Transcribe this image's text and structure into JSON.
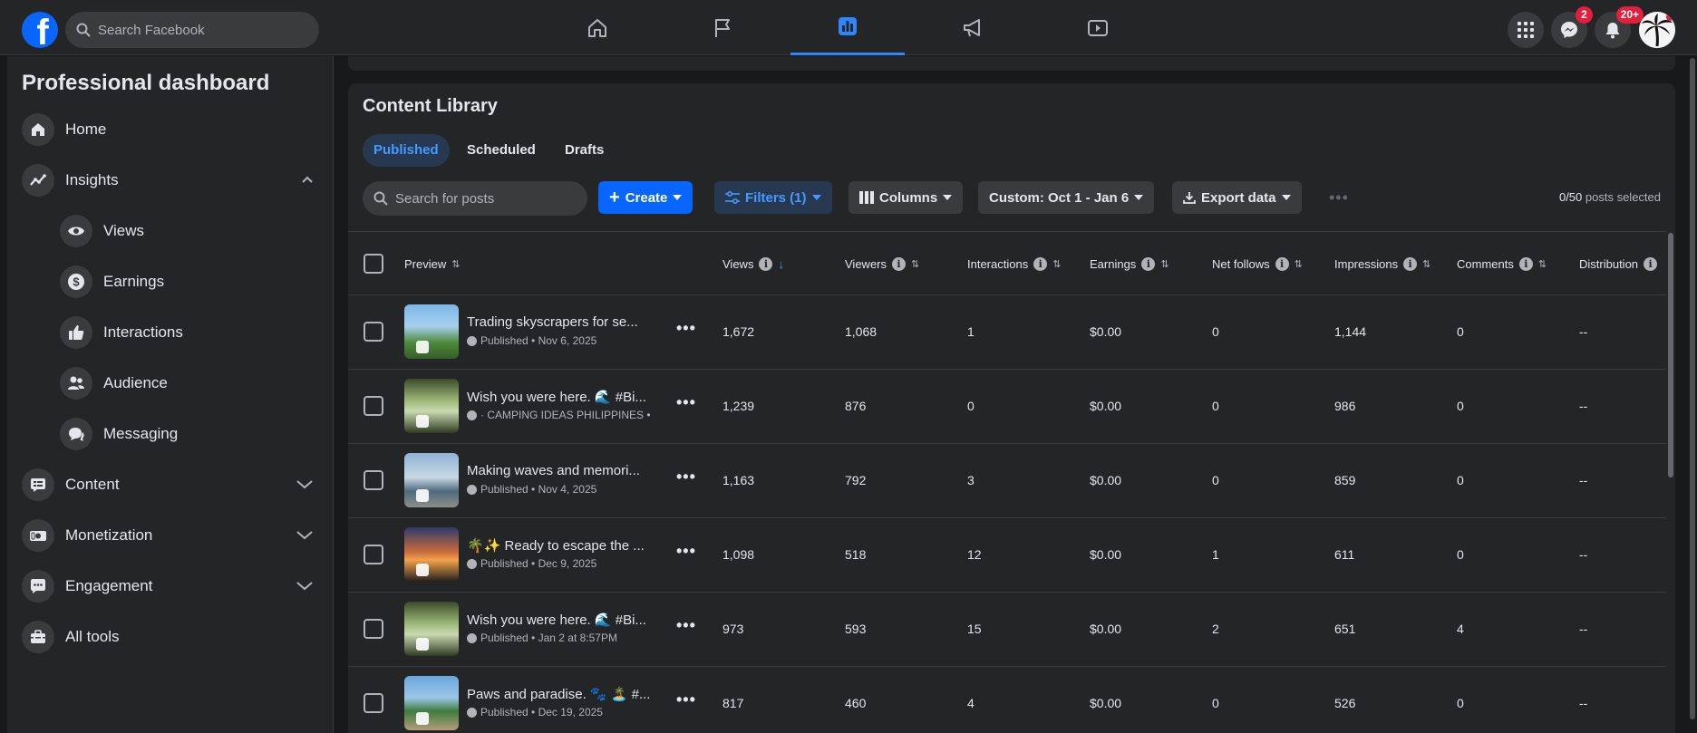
{
  "topbar": {
    "logo_letter": "f",
    "search_placeholder": "Search Facebook",
    "nav_tabs": [
      "home-icon",
      "flag-icon",
      "insights-icon",
      "megaphone-icon",
      "video-icon"
    ],
    "messenger_badge": "2",
    "notifications_badge": "20+"
  },
  "sidebar": {
    "title": "Professional dashboard",
    "items": [
      {
        "label": "Home",
        "icon": "home-icon"
      },
      {
        "label": "Insights",
        "icon": "trend-icon"
      },
      {
        "label": "Views",
        "icon": "eye-icon"
      },
      {
        "label": "Earnings",
        "icon": "dollar-icon"
      },
      {
        "label": "Interactions",
        "icon": "thumbs-up-icon"
      },
      {
        "label": "Audience",
        "icon": "people-icon"
      },
      {
        "label": "Messaging",
        "icon": "chat-icon"
      },
      {
        "label": "Content",
        "icon": "content-icon"
      },
      {
        "label": "Monetization",
        "icon": "money-icon"
      },
      {
        "label": "Engagement",
        "icon": "comment-icon"
      },
      {
        "label": "All tools",
        "icon": "toolbox-icon"
      }
    ]
  },
  "library": {
    "title": "Content Library",
    "tabs": [
      "Published",
      "Scheduled",
      "Drafts"
    ],
    "search_placeholder": "Search for posts",
    "create_label": "Create",
    "filters_label": "Filters (1)",
    "columns_label": "Columns",
    "date_range_label": "Custom: Oct 1 - Jan 6",
    "export_label": "Export data",
    "selected_count": "0/50",
    "selected_suffix": " posts selected",
    "headers": {
      "preview": "Preview",
      "views": "Views",
      "viewers": "Viewers",
      "interactions": "Interactions",
      "earnings": "Earnings",
      "net_follows": "Net follows",
      "impressions": "Impressions",
      "comments": "Comments",
      "distribution": "Distribution"
    },
    "rows": [
      {
        "title": "Trading skyscrapers for se...",
        "meta": "Published • Nov 6, 2025",
        "views": "1,672",
        "viewers": "1,068",
        "interactions": "1",
        "earnings": "$0.00",
        "net_follows": "0",
        "impressions": "1,144",
        "comments": "0",
        "distribution": "--"
      },
      {
        "title": "Wish you were here. 🌊 #Bi...",
        "meta": "· CAMPING IDEAS PHILIPPINES • ",
        "views": "1,239",
        "viewers": "876",
        "interactions": "0",
        "earnings": "$0.00",
        "net_follows": "0",
        "impressions": "986",
        "comments": "0",
        "distribution": "--"
      },
      {
        "title": "Making waves and memori...",
        "meta": "Published • Nov 4, 2025",
        "views": "1,163",
        "viewers": "792",
        "interactions": "3",
        "earnings": "$0.00",
        "net_follows": "0",
        "impressions": "859",
        "comments": "0",
        "distribution": "--"
      },
      {
        "title": "🌴✨ Ready to escape the ...",
        "meta": "Published • Dec 9, 2025",
        "views": "1,098",
        "viewers": "518",
        "interactions": "12",
        "earnings": "$0.00",
        "net_follows": "1",
        "impressions": "611",
        "comments": "0",
        "distribution": "--"
      },
      {
        "title": "Wish you were here. 🌊 #Bi...",
        "meta": "Published • Jan 2 at 8:57PM",
        "views": "973",
        "viewers": "593",
        "interactions": "15",
        "earnings": "$0.00",
        "net_follows": "2",
        "impressions": "651",
        "comments": "4",
        "distribution": "--"
      },
      {
        "title": "Paws and paradise. 🐾 🏝️ #...",
        "meta": "Published • Dec 19, 2025",
        "views": "817",
        "viewers": "460",
        "interactions": "4",
        "earnings": "$0.00",
        "net_follows": "0",
        "impressions": "526",
        "comments": "0",
        "distribution": "--"
      }
    ]
  },
  "colors": {
    "accent": "#0866ff",
    "link": "#4599ff",
    "badge": "#e41e3f",
    "surface": "#242526",
    "background": "#18191a"
  }
}
